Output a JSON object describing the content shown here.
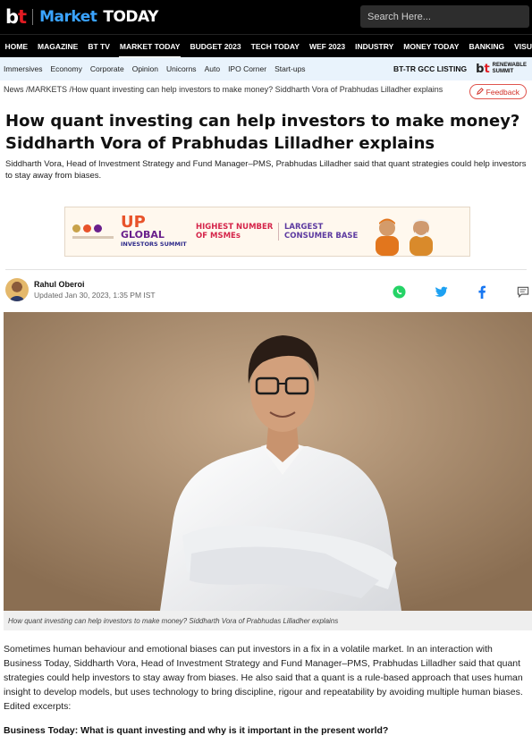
{
  "header": {
    "logo_bt": "bt",
    "logo_market": "Market",
    "logo_today": "TODAY",
    "search_placeholder": "Search Here..."
  },
  "nav": {
    "items": [
      "HOME",
      "MAGAZINE",
      "BT TV",
      "MARKET TODAY",
      "BUDGET 2023",
      "TECH TODAY",
      "WEF 2023",
      "INDUSTRY",
      "MONEY TODAY",
      "BANKING",
      "VISUAL"
    ],
    "active": "MARKET TODAY"
  },
  "subnav": {
    "items": [
      "Immersives",
      "Economy",
      "Corporate",
      "Opinion",
      "Unicorns",
      "Auto",
      "IPO Corner",
      "Start-ups"
    ],
    "gcc_label": "BT-TR GCC LISTING",
    "renewable_line1": "RENEWABLE",
    "renewable_line2": "SUMMIT"
  },
  "breadcrumb": {
    "home": "News",
    "section": "MARKETS",
    "current": "How quant investing can help investors to make money? Siddharth Vora of Prabhudas Lilladher explains"
  },
  "feedback_label": "Feedback",
  "article": {
    "title": "How quant investing can help investors to make money? Siddharth Vora of Prabhudas Lilladher explains",
    "summary": "Siddharth Vora, Head of Investment Strategy and Fund Manager–PMS, Prabhudas Lilladher said that quant strategies could help investors to stay away from biases.",
    "author": "Rahul Oberoi",
    "updated": "Updated Jan 30, 2023, 1:35 PM IST",
    "image_caption": "How quant investing can help investors to make money? Siddharth Vora of Prabhudas Lilladher explains",
    "body": "Sometimes human behaviour and emotional biases can put investors in a fix in a volatile market. In an interaction with Business Today, Siddharth Vora, Head of Investment Strategy and Fund Manager–PMS, Prabhudas Lilladher said that quant strategies could help investors to stay away from biases. He also said that a quant is a rule-based approach that uses human insight to develop models, but uses technology to bring discipline, rigour and repeatability by avoiding multiple human biases. Edited excerpts:",
    "question": "Business Today: What is quant investing and why is it important in the present world?"
  },
  "ad": {
    "logo_line1": "UP",
    "logo_line2": "GLOBAL",
    "logo_line3": "INVESTORS SUMMIT",
    "text1": "HIGHEST NUMBER OF MSMEs",
    "text2": "LARGEST CONSUMER BASE"
  },
  "share_icons": [
    "whatsapp-icon",
    "twitter-icon",
    "facebook-icon",
    "comment-icon"
  ],
  "colors": {
    "brand_red": "#e01b22",
    "brand_blue": "#3aa3ff",
    "subnav_bg": "#e9f3fc",
    "whatsapp": "#25d366",
    "twitter": "#1da1f2",
    "facebook": "#1877f2"
  }
}
